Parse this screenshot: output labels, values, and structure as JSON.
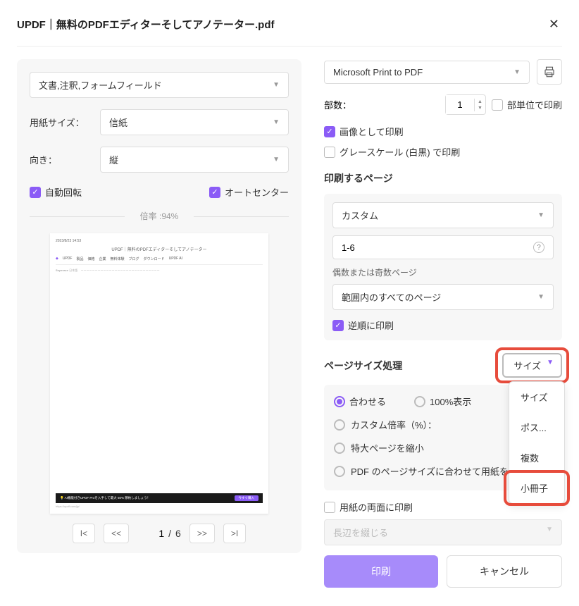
{
  "title": "UPDF｜無料のPDFエディターそしてアノテーター.pdf",
  "left": {
    "mode": "文書,注釈,フォームフィールド",
    "paperSizeLabel": "用紙サイズ：",
    "paperSize": "信紙",
    "orientationLabel": "向き：",
    "orientation": "縦",
    "autoRotate": "自動回転",
    "autoCenter": "オートセンター",
    "scale": "倍率 :94%",
    "preview": {
      "timestamp": "2023/8/23 14:53",
      "pageTitle": "UPDF｜無料のPDFエディターそしてアノテーター",
      "nav": [
        "UPDF",
        "製品",
        "価格",
        "企業",
        "無料体験",
        "ブログ",
        "ダウンロード",
        "",
        "UPDF AI"
      ],
      "banner": "AI機能付きUPDF Proを入手して最大 50% 節約しましょう！",
      "bannerBtn": "今すぐ購入",
      "url": "https://updf.com/jp/"
    },
    "pager": {
      "current": "1",
      "sep": "/",
      "total": "6"
    }
  },
  "right": {
    "printer": "Microsoft Print to PDF",
    "copiesLabel": "部数：",
    "copies": "1",
    "collate": "部単位で印刷",
    "printAsImage": "画像として印刷",
    "grayscale": "グレースケール (白黒) で印刷",
    "pagesTitle": "印刷するページ",
    "pageMode": "カスタム",
    "pageRange": "1-6",
    "oddEvenLabel": "偶数または奇数ページ",
    "oddEven": "範囲内のすべてのページ",
    "reverse": "逆順に印刷",
    "sizeHandlingTitle": "ページサイズ処理",
    "sizeDropdown": "サイズ",
    "sizeOptions": [
      "サイズ",
      "ポス...",
      "複数",
      "小冊子"
    ],
    "radios": {
      "fit": "合わせる",
      "hundred": "100%表示",
      "customScale": "カスタム倍率（%）：",
      "shrinkLarge": "特大ページを縮小",
      "chooseByPdf": "PDF のページサイズに合わせて用紙を"
    },
    "duplex": "用紙の両面に印刷",
    "binding": "長辺を綴じる",
    "print": "印刷",
    "cancel": "キャンセル"
  }
}
